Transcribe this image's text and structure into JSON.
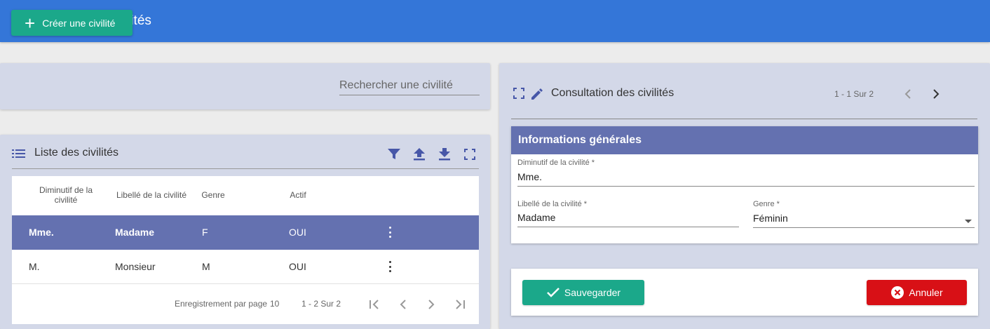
{
  "header": {
    "title": "Gestion des civilités",
    "icon": "shield-gear-icon"
  },
  "toolbar": {
    "create_label": "Créer une civilité",
    "search_placeholder": "Rechercher une civilité"
  },
  "list": {
    "title": "Liste des civilités",
    "columns": [
      "Diminutif de la civilité",
      "Libellé de la civilité",
      "Genre",
      "Actif"
    ],
    "rows": [
      {
        "diminutif": "Mme.",
        "libelle": "Madame",
        "genre": "F",
        "actif": "OUI",
        "selected": true
      },
      {
        "diminutif": "M.",
        "libelle": "Monsieur",
        "genre": "M",
        "actif": "OUI",
        "selected": false
      }
    ],
    "pager": {
      "per_page_label": "Enregistrement par page",
      "per_page": "10",
      "range": "1 - 2 Sur 2"
    }
  },
  "consultation": {
    "title": "Consultation des civilités",
    "pager": "1 - 1 Sur 2",
    "section_title": "Informations générales",
    "fields": {
      "diminutif_label": "Diminutif de la civilité *",
      "diminutif_value": "Mme.",
      "libelle_label": "Libellé de la civilité *",
      "libelle_value": "Madame",
      "genre_label": "Genre *",
      "genre_value": "Féminin"
    },
    "save_label": "Sauvegarder",
    "cancel_label": "Annuler"
  },
  "colors": {
    "header": "#3476d8",
    "accent_green": "#1ba88a",
    "selected_row": "#6471b0",
    "cancel_red": "#d81016",
    "card_bg": "#d3d8e8"
  }
}
